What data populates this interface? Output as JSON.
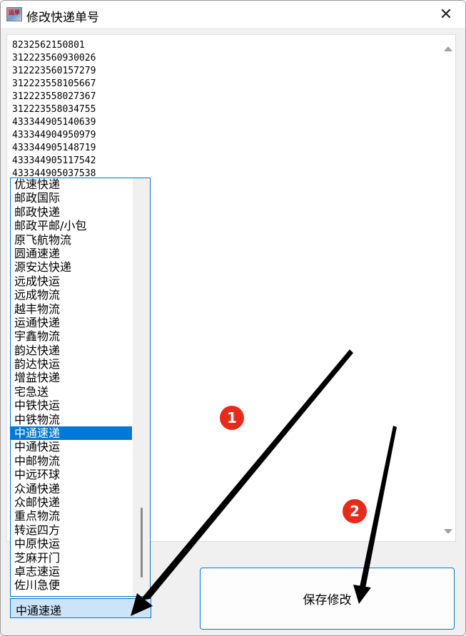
{
  "window": {
    "title": "修改快递单号",
    "icon_text": "运单",
    "close_glyph": "✕"
  },
  "tracking_numbers": [
    "8232562150801",
    "312223560930026",
    "312223560157279",
    "312223558105667",
    "312223558027367",
    "312223558034755",
    "433344905140639",
    "433344904950979",
    "433344905148719",
    "433344905117542",
    "433344905037538"
  ],
  "courier_list": {
    "items": [
      "优速快递",
      "邮政国际",
      "邮政快递",
      "邮政平邮/小包",
      "原飞航物流",
      "圆通速递",
      "源安达快递",
      "远成快运",
      "远成物流",
      "越丰物流",
      "运通快递",
      "宇鑫物流",
      "韵达快递",
      "韵达快运",
      "增益快递",
      "宅急送",
      "中铁快运",
      "中铁物流",
      "中通速递",
      "中通快运",
      "中邮物流",
      "中远环球",
      "众通快递",
      "众邮快递",
      "重点物流",
      "转运四方",
      "中原快运",
      "芝麻开门",
      "卓志速运",
      "佐川急便"
    ],
    "selected_index": 18
  },
  "combo": {
    "value": "中通速递"
  },
  "save_button": {
    "label": "保存修改"
  },
  "annotations": [
    {
      "label": "1",
      "color": "#e52b1a"
    },
    {
      "label": "2",
      "color": "#e52b1a"
    }
  ],
  "colors": {
    "accent": "#0078d7",
    "marker": "#e52b1a"
  }
}
